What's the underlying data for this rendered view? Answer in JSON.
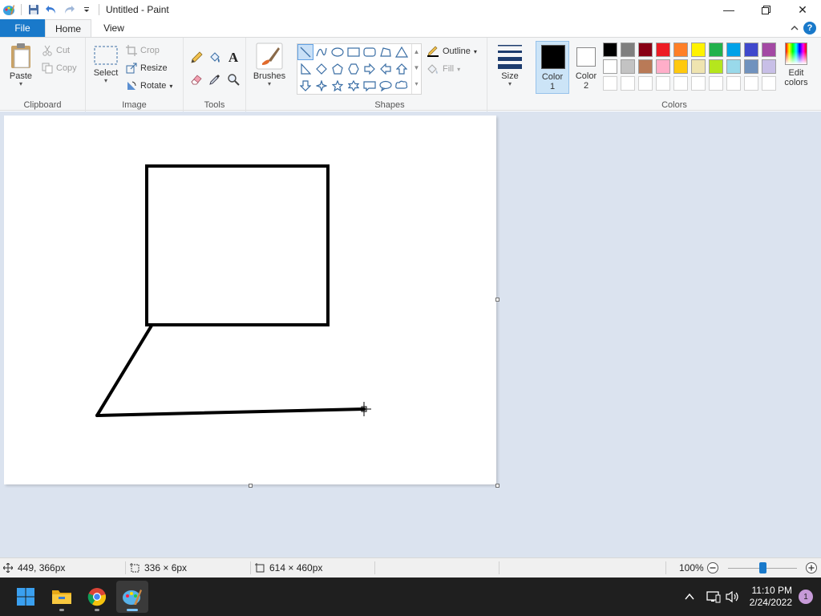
{
  "window": {
    "title": "Untitled - Paint",
    "minimize_glyph": "—",
    "close_glyph": "✕"
  },
  "tabs": [
    {
      "label": "File"
    },
    {
      "label": "Home"
    },
    {
      "label": "View"
    }
  ],
  "help": {
    "label": "?"
  },
  "ribbon": {
    "clipboard": {
      "group_label": "Clipboard",
      "paste_label": "Paste",
      "cut_label": "Cut",
      "copy_label": "Copy"
    },
    "image": {
      "group_label": "Image",
      "select_label": "Select",
      "crop_label": "Crop",
      "resize_label": "Resize",
      "rotate_label": "Rotate"
    },
    "tools": {
      "group_label": "Tools",
      "icons": [
        "pencil-icon",
        "fill-bucket-icon",
        "text-icon",
        "eraser-icon",
        "color-picker-icon",
        "magnifier-icon"
      ],
      "text_glyph": "A"
    },
    "brushes": {
      "label": "Brushes"
    },
    "shapes": {
      "group_label": "Shapes",
      "selected": "line",
      "outline_label": "Outline",
      "fill_label": "Fill"
    },
    "size": {
      "label": "Size"
    },
    "colors": {
      "group_label": "Colors",
      "color1_label": "Color",
      "color1_num": "1",
      "color2_label": "Color",
      "color2_num": "2",
      "color1_value": "#000000",
      "color2_value": "#ffffff",
      "edit_label_1": "Edit",
      "edit_label_2": "colors",
      "palette_row1": [
        "#000000",
        "#7f7f7f",
        "#880015",
        "#ed1c24",
        "#ff7f27",
        "#fff200",
        "#22b14c",
        "#00a2e8",
        "#3f48cc",
        "#a349a4"
      ],
      "palette_row2": [
        "#ffffff",
        "#c3c3c3",
        "#b97a57",
        "#ffaec9",
        "#ffc90e",
        "#efe4b0",
        "#b5e61d",
        "#99d9ea",
        "#7092be",
        "#c8bfe7"
      ]
    }
  },
  "statusbar": {
    "cursor_pos": "449, 366px",
    "selection_size": "336 × 6px",
    "canvas_size": "614 × 460px",
    "zoom": "100%",
    "zoom_slider_value": 0.5
  },
  "taskbar": {
    "apps": [
      "windows-start",
      "file-explorer",
      "chrome",
      "paint"
    ],
    "time": "11:10 PM",
    "date": "2/24/2022",
    "notification_count": "1"
  },
  "colors": {
    "accent": "#1979ca",
    "workspace_bg": "#dbe3ef",
    "ribbon_bg": "#f5f6f7"
  }
}
